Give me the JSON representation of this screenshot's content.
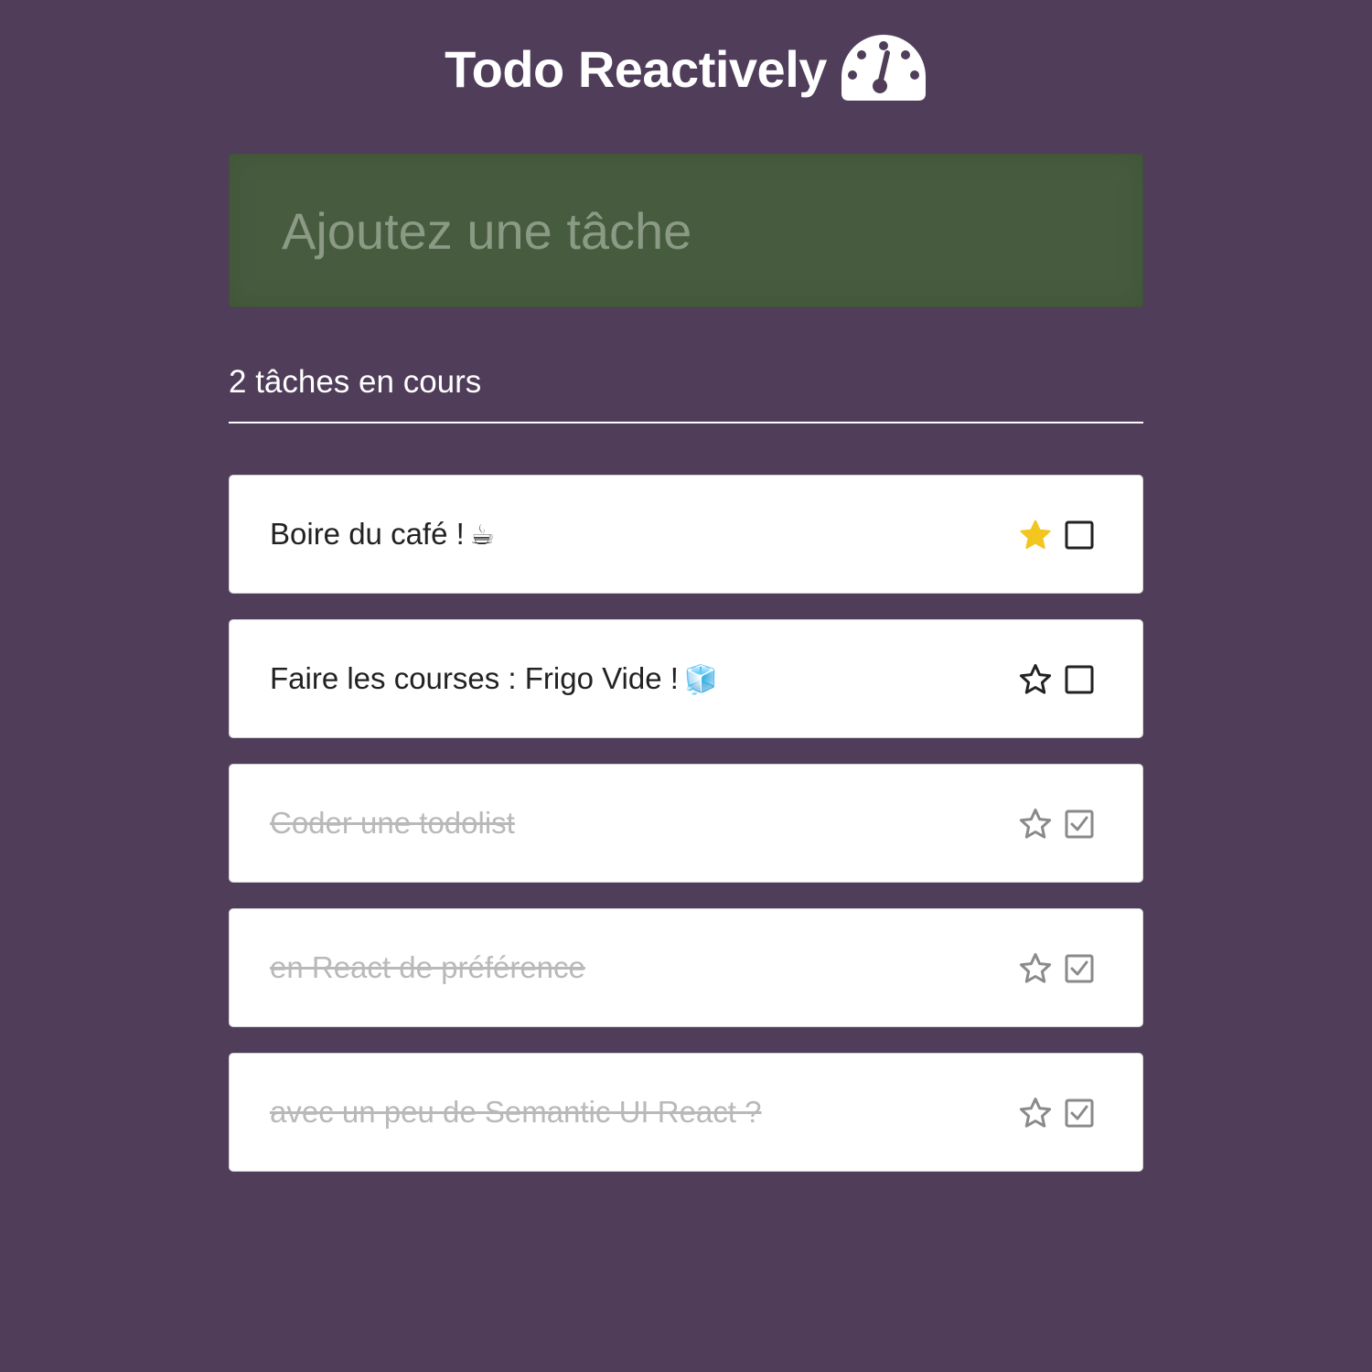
{
  "header": {
    "title": "Todo Reactively",
    "icon": "dashboard-gauge-icon"
  },
  "add_form": {
    "placeholder": "Ajoutez une tâche",
    "value": ""
  },
  "counter": {
    "text": "2 tâches en cours"
  },
  "tasks": [
    {
      "label": "Boire du café !",
      "emoji": "☕",
      "favorite": true,
      "done": false
    },
    {
      "label": "Faire les courses : Frigo Vide !",
      "emoji": "🧊",
      "favorite": false,
      "done": false
    },
    {
      "label": "Coder une todolist",
      "emoji": "",
      "favorite": false,
      "done": true
    },
    {
      "label": "en React de préférence",
      "emoji": "",
      "favorite": false,
      "done": true
    },
    {
      "label": "avec un peu de Semantic UI React ?",
      "emoji": "",
      "favorite": false,
      "done": true
    }
  ],
  "colors": {
    "background": "#4f3d5a",
    "input_background": "#475b3f",
    "star_active": "#f2c61f",
    "text_active": "#222222",
    "text_done": "#b9b9b9",
    "icon_done": "#8a8a8a"
  }
}
